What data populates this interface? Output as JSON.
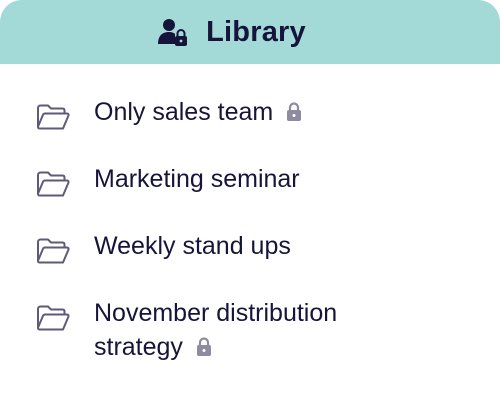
{
  "header": {
    "title": "Library",
    "icon": "user-lock-icon"
  },
  "items": [
    {
      "label": "Only sales team",
      "locked": true,
      "icon": "folder-icon"
    },
    {
      "label": "Marketing seminar",
      "locked": false,
      "icon": "folder-icon"
    },
    {
      "label": "Weekly stand ups",
      "locked": false,
      "icon": "folder-icon"
    },
    {
      "label": "November distribution strategy",
      "locked": true,
      "icon": "folder-icon"
    }
  ],
  "colors": {
    "header_bg": "#a3d9d7",
    "text": "#16143a",
    "folder_stroke": "#5e5a78",
    "lock": "#8e8aa0"
  }
}
